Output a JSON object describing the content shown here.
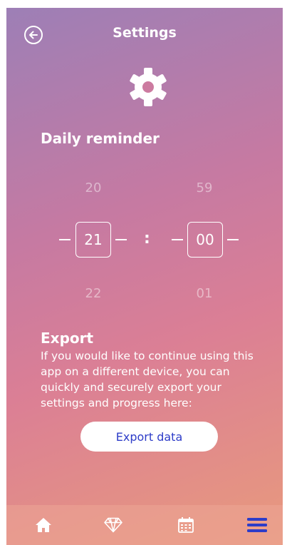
{
  "header": {
    "title": "Settings"
  },
  "reminder": {
    "title": "Daily reminder",
    "hours": {
      "prev": "20",
      "current": "21",
      "next": "22"
    },
    "minutes": {
      "prev": "59",
      "current": "00",
      "next": "01"
    },
    "separator": ":"
  },
  "export": {
    "title": "Export",
    "description": "If you would like to continue using this app on a different device, you can quickly and securely export your settings and progress here:",
    "button_label": "Export data"
  },
  "tabbar": {
    "items": [
      {
        "icon": "home-icon"
      },
      {
        "icon": "diamond-icon"
      },
      {
        "icon": "calendar-icon"
      },
      {
        "icon": "menu-icon",
        "active": true
      }
    ]
  },
  "colors": {
    "accent": "#2d3cc8",
    "text": "#ffffff"
  }
}
